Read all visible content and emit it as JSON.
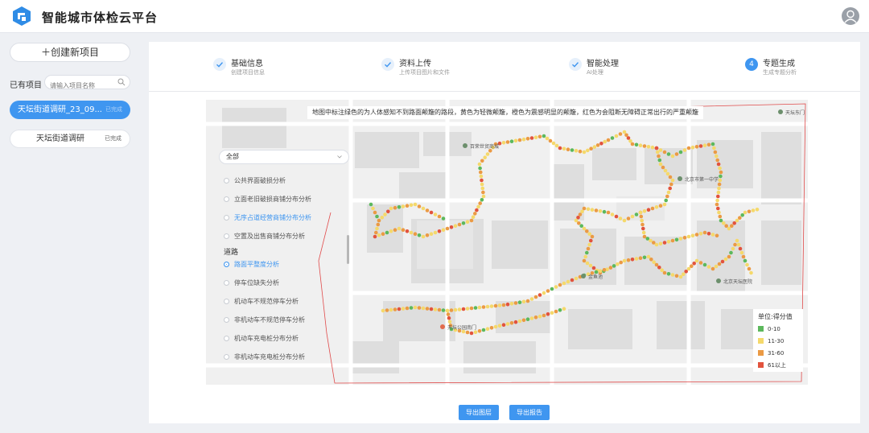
{
  "app": {
    "title": "智能城市体检云平台"
  },
  "sidebar": {
    "new_project_label": "＋创建新项目",
    "existing_label": "已有项目",
    "search_placeholder": "请输入项目名称",
    "projects": [
      {
        "name": "天坛街道调研_23_09...",
        "status": "已完成"
      },
      {
        "name": "天坛街道调研",
        "status": "已完成"
      }
    ]
  },
  "steps": [
    {
      "title": "基础信息",
      "subtitle": "创建项目信息",
      "state": "done"
    },
    {
      "title": "资料上传",
      "subtitle": "上传项目图片和文件",
      "state": "done"
    },
    {
      "title": "智能处理",
      "subtitle": "AI处理",
      "state": "done"
    },
    {
      "number": "4",
      "title": "专题生成",
      "subtitle": "生成专题分析",
      "state": "current"
    }
  ],
  "map": {
    "note": "地图中标注绿色的为人体感知不到路面颠簸的路段，黄色为轻微颠簸，橙色为震感明显的颠簸，红色为会阻断无障碍正常出行的严重颠簸",
    "filter_selected": "全部",
    "filters": [
      {
        "label": "公共界面破损分析",
        "kind": "item"
      },
      {
        "label": "立面老旧破损商铺分布分析",
        "kind": "item"
      },
      {
        "label": "无序占道经营商铺分布分析",
        "kind": "link"
      },
      {
        "label": "空置及出售商铺分布分析",
        "kind": "item"
      },
      {
        "label": "道路",
        "kind": "group"
      },
      {
        "label": "路面平整度分析",
        "kind": "selected"
      },
      {
        "label": "停车位缺失分析",
        "kind": "item"
      },
      {
        "label": "机动车不规范停车分析",
        "kind": "item"
      },
      {
        "label": "非机动车不规范停车分析",
        "kind": "item"
      },
      {
        "label": "机动车充电桩分布分析",
        "kind": "item"
      },
      {
        "label": "非机动车充电桩分布分析",
        "kind": "item"
      }
    ],
    "places": [
      "百荣世贸商城",
      "天坛公园南门",
      "金鱼池",
      "北京市第一中学",
      "北京天坛医院",
      "天坛东门"
    ],
    "legend": {
      "title": "单位:得分值",
      "items": [
        {
          "label": "0-10",
          "color": "#5cb85c"
        },
        {
          "label": "11-30",
          "color": "#f5d96b"
        },
        {
          "label": "31-60",
          "color": "#eb9a44"
        },
        {
          "label": "61以上",
          "color": "#e2533d"
        }
      ]
    }
  },
  "buttons": {
    "export_layer": "导出图层",
    "export_report": "导出报告"
  },
  "colors": {
    "accent": "#3f96f0",
    "route_border": "#e04a4a"
  }
}
